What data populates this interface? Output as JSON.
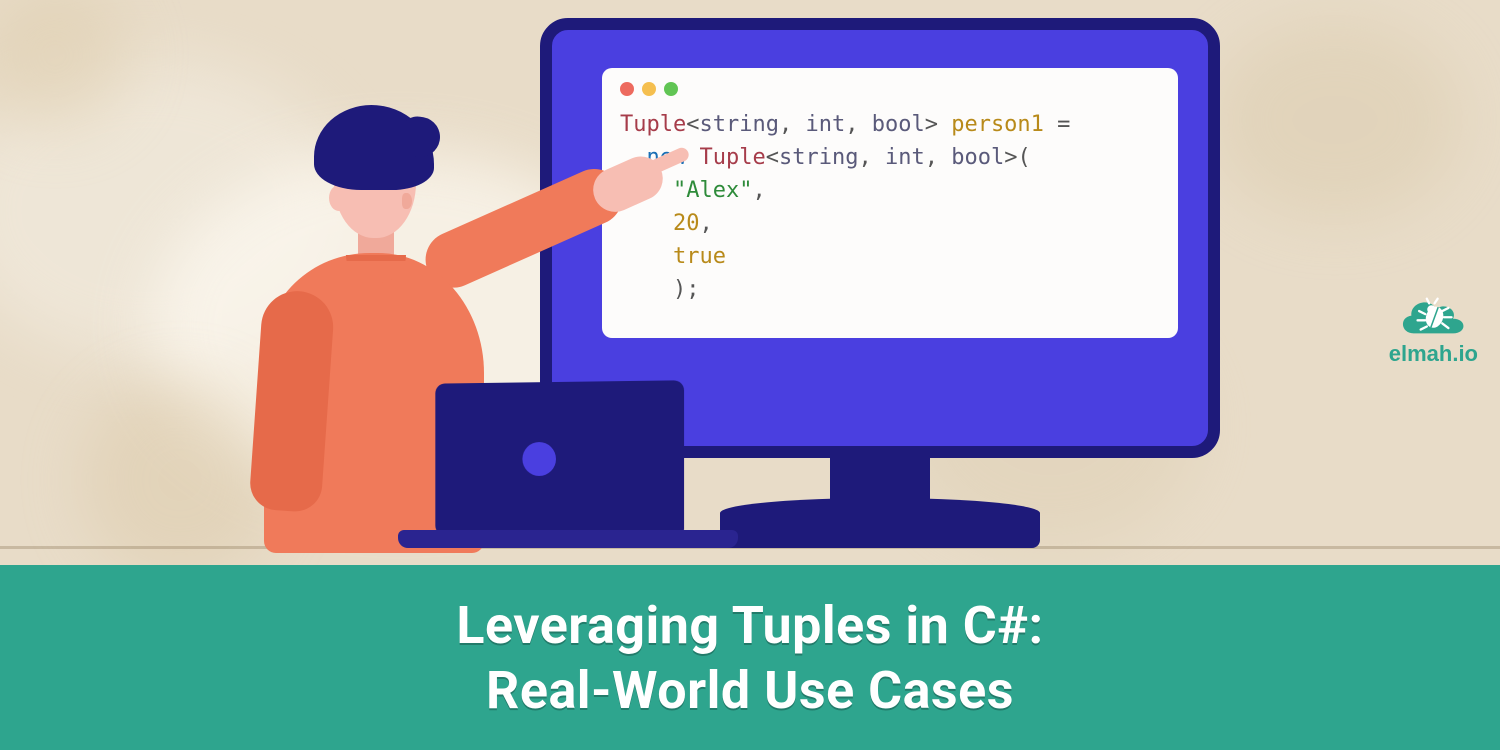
{
  "title": {
    "line1": "Leveraging Tuples in C#:",
    "line2": "Real-World Use Cases"
  },
  "brand": {
    "name": "elmah.io"
  },
  "code": {
    "window_dots": [
      "red",
      "yellow",
      "green"
    ],
    "lines": [
      {
        "indent": 0,
        "tokens": [
          {
            "t": "type",
            "v": "Tuple"
          },
          {
            "t": "pun",
            "v": "<"
          },
          {
            "t": "gen",
            "v": "string"
          },
          {
            "t": "pun",
            "v": ","
          },
          {
            "t": "raw",
            "v": " "
          },
          {
            "t": "gen",
            "v": "int"
          },
          {
            "t": "pun",
            "v": ","
          },
          {
            "t": "raw",
            "v": " "
          },
          {
            "t": "gen",
            "v": "bool"
          },
          {
            "t": "pun",
            "v": ">"
          },
          {
            "t": "raw",
            "v": " "
          },
          {
            "t": "var",
            "v": "person1"
          },
          {
            "t": "raw",
            "v": " "
          },
          {
            "t": "pun",
            "v": "="
          }
        ]
      },
      {
        "indent": 1,
        "tokens": [
          {
            "t": "kw",
            "v": "new"
          },
          {
            "t": "raw",
            "v": " "
          },
          {
            "t": "type",
            "v": "Tuple"
          },
          {
            "t": "pun",
            "v": "<"
          },
          {
            "t": "gen",
            "v": "string"
          },
          {
            "t": "pun",
            "v": ","
          },
          {
            "t": "raw",
            "v": " "
          },
          {
            "t": "gen",
            "v": "int"
          },
          {
            "t": "pun",
            "v": ","
          },
          {
            "t": "raw",
            "v": " "
          },
          {
            "t": "gen",
            "v": "bool"
          },
          {
            "t": "pun",
            "v": ">"
          },
          {
            "t": "pun",
            "v": "("
          }
        ]
      },
      {
        "indent": 2,
        "tokens": [
          {
            "t": "str",
            "v": "\"Alex\""
          },
          {
            "t": "pun",
            "v": ","
          }
        ]
      },
      {
        "indent": 2,
        "tokens": [
          {
            "t": "num",
            "v": "20"
          },
          {
            "t": "pun",
            "v": ","
          }
        ]
      },
      {
        "indent": 2,
        "tokens": [
          {
            "t": "bool",
            "v": "true"
          }
        ]
      },
      {
        "indent": 2,
        "tokens": [
          {
            "t": "pun",
            "v": ");"
          }
        ]
      }
    ]
  },
  "colors": {
    "accent": "#2ea58e",
    "monitor_frame": "#1e1a7a",
    "monitor_screen": "#4a3fe0",
    "shirt": "#f07a5a",
    "skin": "#f7beb3",
    "bg": "#e8dcc8"
  }
}
